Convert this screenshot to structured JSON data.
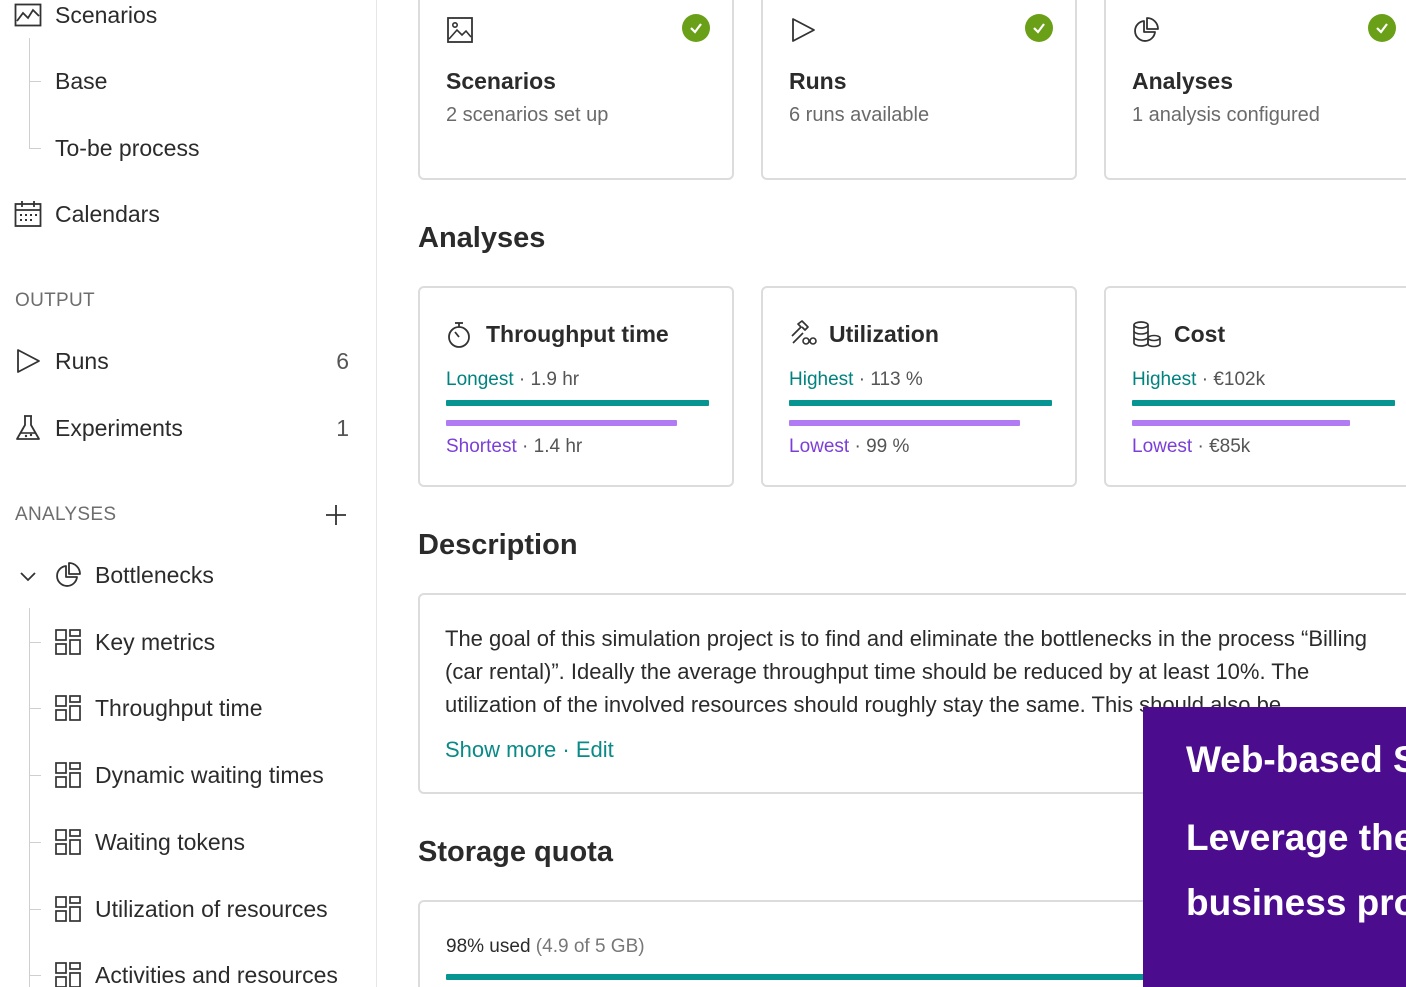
{
  "sidebar": {
    "scenarios_label": "Scenarios",
    "scenario_items": [
      "Base",
      "To-be process"
    ],
    "calendars_label": "Calendars",
    "output_section": "OUTPUT",
    "runs": {
      "label": "Runs",
      "count": "6"
    },
    "experiments": {
      "label": "Experiments",
      "count": "1"
    },
    "analyses_section": "ANALYSES",
    "bottlenecks_label": "Bottlenecks",
    "analysis_items": [
      "Key metrics",
      "Throughput time",
      "Dynamic waiting times",
      "Waiting tokens",
      "Utilization of resources",
      "Activities and resources"
    ]
  },
  "summary_cards": [
    {
      "icon": "image-icon",
      "title": "Scenarios",
      "subtitle": "2 scenarios set up"
    },
    {
      "icon": "play-icon",
      "title": "Runs",
      "subtitle": "6 runs available"
    },
    {
      "icon": "pie-chart-icon",
      "title": "Analyses",
      "subtitle": "1 analysis configured"
    }
  ],
  "analyses": {
    "heading": "Analyses",
    "cards": [
      {
        "icon": "stopwatch-icon",
        "title": "Throughput time",
        "top_label": "Longest",
        "top_value": "1.9 hr",
        "top_fill": 1.0,
        "bottom_label": "Shortest",
        "bottom_value": "1.4 hr",
        "bottom_fill": 0.88
      },
      {
        "icon": "tools-icon",
        "title": "Utilization",
        "top_label": "Highest",
        "top_value": "113 %",
        "top_fill": 1.0,
        "bottom_label": "Lowest",
        "bottom_value": "99 %",
        "bottom_fill": 0.88
      },
      {
        "icon": "coins-icon",
        "title": "Cost",
        "top_label": "Highest",
        "top_value": "€102k",
        "top_fill": 1.0,
        "bottom_label": "Lowest",
        "bottom_value": "€85k",
        "bottom_fill": 0.83
      }
    ]
  },
  "description": {
    "heading": "Description",
    "text": "The goal of this simulation project is to find and eliminate the bottlenecks in the process “Billing (car rental)”. Ideally the average throughput time should be reduced by at least 10%. The utilization of the involved resources should roughly stay the same. This should also be",
    "show_more": "Show more",
    "separator": "·",
    "edit": "Edit"
  },
  "storage": {
    "heading": "Storage quota",
    "used": "98% used",
    "detail": "(4.9 of 5 GB)",
    "fill": 0.98
  },
  "banner": {
    "line1": "Web-based S",
    "line2": "Leverage the",
    "line3": "business pro"
  },
  "colors": {
    "teal": "#079591",
    "purple": "#b07bf3",
    "check": "#6aa018",
    "banner": "#4b0c8e"
  }
}
